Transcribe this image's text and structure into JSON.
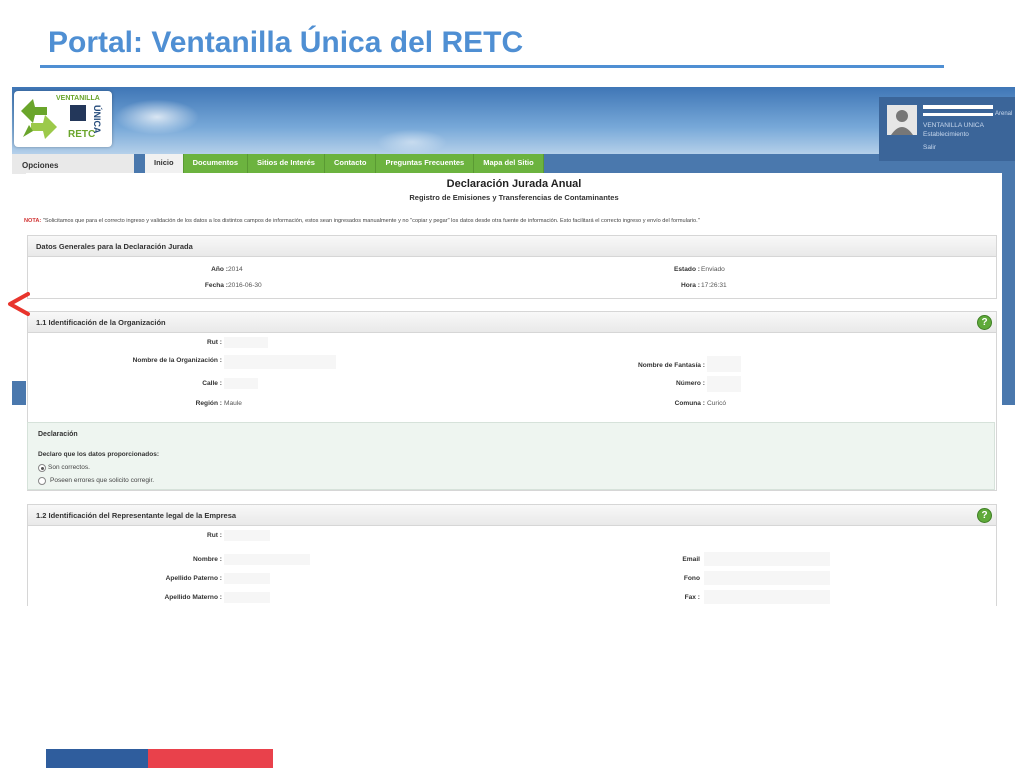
{
  "slide": {
    "title": "Portal: Ventanilla Única del RETC"
  },
  "logo": {
    "top_text": "VENTANILLA",
    "side_text": "ÚNICA",
    "bottom_text": "RETC"
  },
  "user": {
    "extra": "Arenal",
    "role": "VENTANILLA UNICA",
    "sub": "Establecimiento",
    "exit": "Salir"
  },
  "nav": {
    "opciones": "Opciones",
    "tabs": [
      "Inicio",
      "Documentos",
      "Sitios de Interés",
      "Contacto",
      "Preguntas Frecuentes",
      "Mapa del Sitio"
    ]
  },
  "header": {
    "title": "Declaración Jurada Anual",
    "subtitle": "Registro de Emisiones y Transferencias de Contaminantes",
    "nota_label": "NOTA:",
    "nota_text": "\"Solicitamos que para el correcto ingreso y validación de los datos a los distintos campos de información, estos sean ingresados manualmente y no \"copiar y pegar\" los datos desde otra fuente de información. Esto facilitará el correcto ingreso y envío del formulario.\""
  },
  "datos_generales": {
    "title": "Datos Generales para la Declaración Jurada",
    "anio_label": "Año :",
    "anio_value": "2014",
    "estado_label": "Estado :",
    "estado_value": "Enviado",
    "fecha_label": "Fecha :",
    "fecha_value": "2016-06-30",
    "hora_label": "Hora :",
    "hora_value": "17:26:31"
  },
  "organizacion": {
    "title": "1.1 Identificación de la Organización",
    "rut_label": "Rut :",
    "nombre_label": "Nombre de la Organización :",
    "fantasia_label": "Nombre de Fantasía :",
    "calle_label": "Calle :",
    "numero_label": "Número :",
    "region_label": "Región :",
    "region_value": "Maule",
    "comuna_label": "Comuna :",
    "comuna_value": "Curicó"
  },
  "declaracion": {
    "title": "Declaración",
    "question": "Declaro que los datos proporcionados:",
    "option_yes": "Son correctos.",
    "option_no": "Poseen errores que solicito corregir."
  },
  "representante": {
    "title": "1.2 Identificación del Representante legal de la Empresa",
    "rut_label": "Rut :",
    "nombre_label": "Nombre :",
    "paterno_label": "Apellido Paterno :",
    "materno_label": "Apellido Materno :",
    "email_label": "Email",
    "fono_label": "Fono",
    "fax_label": "Fax :"
  },
  "colors": {
    "title_blue": "#4f8fd3",
    "tab_green": "#6cb33f",
    "footer_blue": "#2f5d9d",
    "footer_red": "#e9414b",
    "alert_red": "#e8342c"
  }
}
